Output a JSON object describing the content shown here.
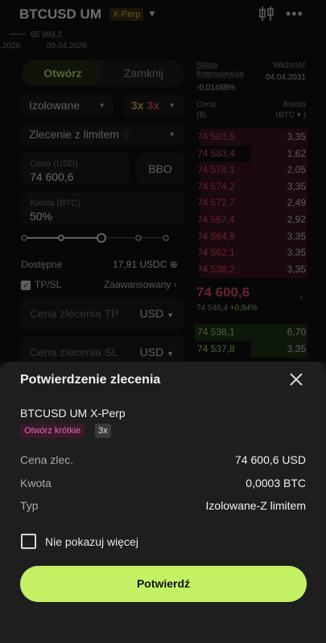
{
  "header": {
    "symbol": "BTCUSD UM",
    "contract": "X-Perp",
    "mini_price": "65 989,2",
    "date_left": ".2026",
    "date_mid": "09.04.2026"
  },
  "form": {
    "tab_open": "Otwórz",
    "tab_close": "Zamknij",
    "margin_mode": "Izolowane",
    "leverage_a": "3x",
    "leverage_b": "3x",
    "order_type": "Zlecenie z limitem",
    "price_label": "Cena (USD)",
    "price_value": "74 600,6",
    "bbo": "BBO",
    "qty_label": "Kwota (BTC)",
    "qty_value": "50%",
    "slider_fraction": 0.5,
    "available_label": "Dostępne",
    "available_value": "17,91 USDC",
    "tpsl_label": "TP/SL",
    "advanced_label": "Zaawansowany",
    "tp_placeholder": "Cena zlecenia TP",
    "tp_currency": "USD",
    "sl_placeholder": "Cena zlecenia SL",
    "sl_currency": "USD"
  },
  "book": {
    "funding_label": "Stopa finansowania",
    "funding_value": "-0,01468%",
    "expiry_label": "Ważność",
    "expiry_value": "04.04.2031",
    "col_price": "Cena",
    "col_price_unit": "($)",
    "col_qty": "Kwota",
    "col_qty_unit": "(BTC ▾ )",
    "asks": [
      {
        "price": "74 583,5",
        "qty": "3,35",
        "depth": 0.95
      },
      {
        "price": "74 583,4",
        "qty": "1,62",
        "depth": 0.5
      },
      {
        "price": "74 578,1",
        "qty": "2,05",
        "depth": 0.95
      },
      {
        "price": "74 574,2",
        "qty": "3,35",
        "depth": 0.95
      },
      {
        "price": "74 572,7",
        "qty": "2,49",
        "depth": 0.95
      },
      {
        "price": "74 567,4",
        "qty": "2,92",
        "depth": 0.95
      },
      {
        "price": "74 564,9",
        "qty": "3,35",
        "depth": 0.95
      },
      {
        "price": "74 562,1",
        "qty": "3,35",
        "depth": 0.95
      },
      {
        "price": "74 538,2",
        "qty": "3,35",
        "depth": 0.95
      }
    ],
    "mid_price": "74 600,6",
    "mark_price": "74 548,4",
    "change": "+0,94%",
    "bids": [
      {
        "price": "74 538,1",
        "qty": "6,70",
        "depth": 1.0
      },
      {
        "price": "74 537,8",
        "qty": "3,35",
        "depth": 0.5
      }
    ]
  },
  "sheet": {
    "title": "Potwierdzenie zlecenia",
    "instrument": "BTCUSD UM X-Perp",
    "side_tag": "Otwórz krótkie",
    "leverage_tag": "3x",
    "price_label": "Cena zlec.",
    "price_value": "74 600,6 USD",
    "qty_label": "Kwota",
    "qty_value": "0,0003 BTC",
    "type_label": "Typ",
    "type_value": "Izolowane-Z limitem",
    "dont_show": "Nie pokazuj więcej",
    "confirm": "Potwierdź"
  },
  "colors": {
    "accent": "#c4f064",
    "ask": "#e44b6a",
    "bid": "#a6d96a",
    "sheet_bg": "#1e1e1e"
  }
}
